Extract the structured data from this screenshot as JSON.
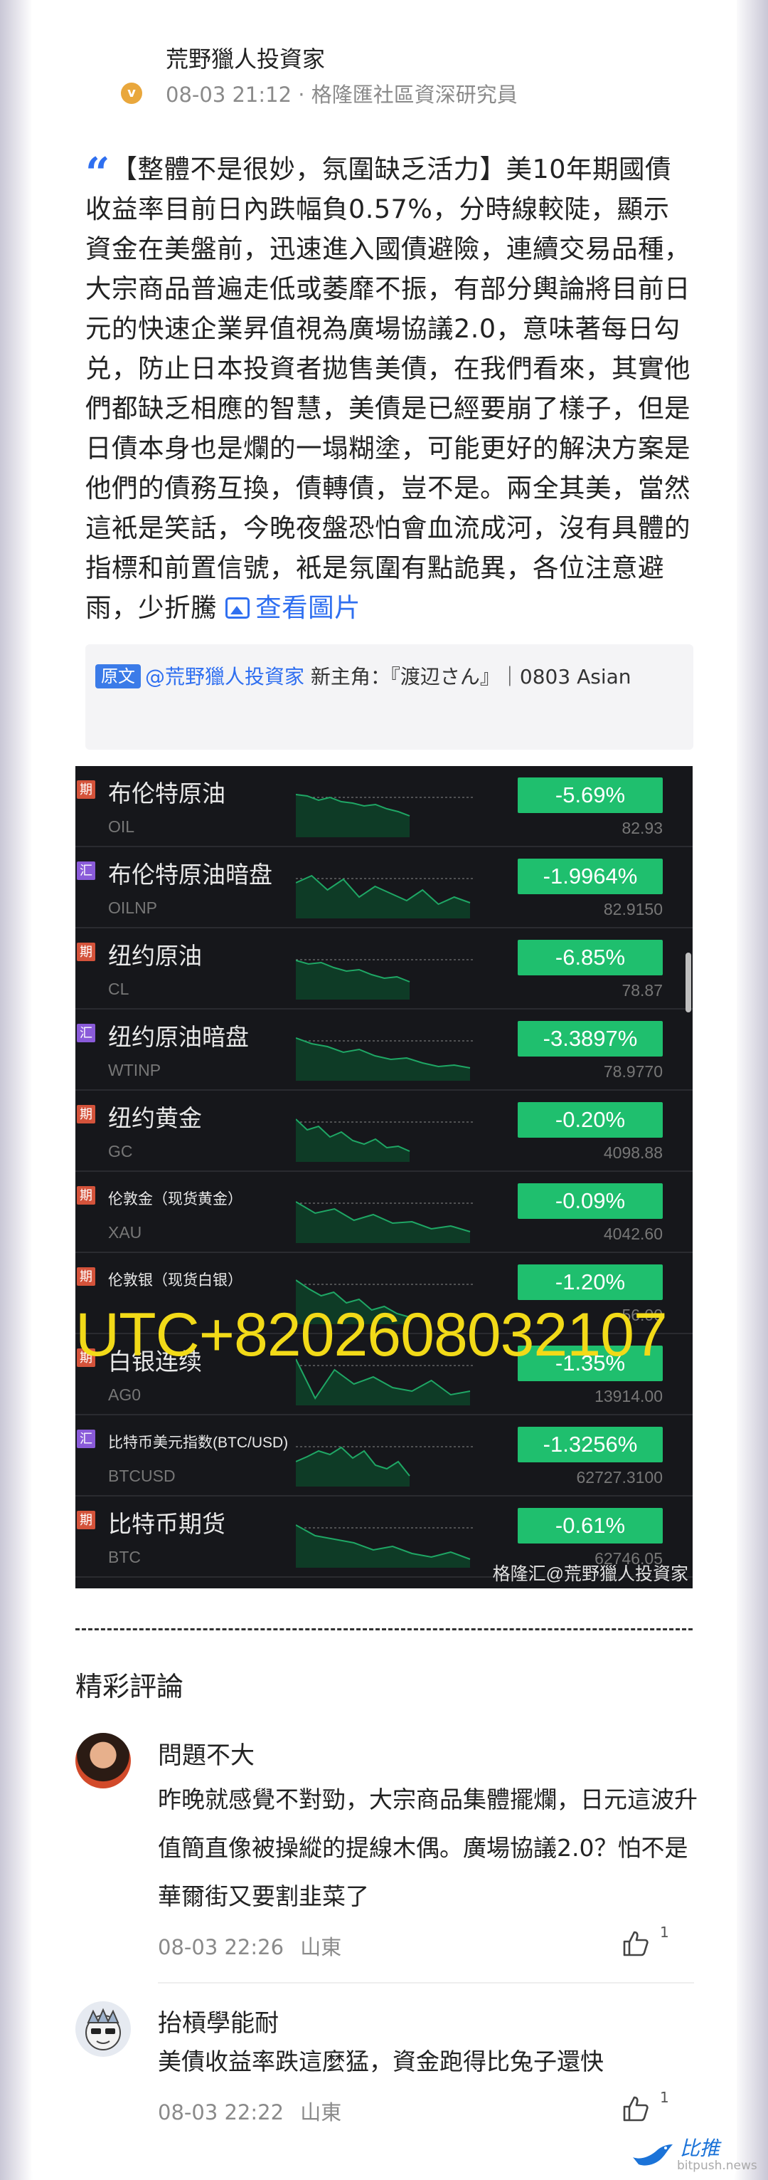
{
  "post": {
    "author": "荒野獵人投資家",
    "timestamp": "08-03 21:12",
    "author_title": "格隆匯社區資深研究員",
    "body": "【整體不是很妙，氛圍缺乏活力】美10年期國債收益率目前日內跌幅負0.57%，分時線較陡，顯示資金在美盤前，迅速進入國債避險，連續交易品種，大宗商品普遍走低或萎靡不振，有部分輿論將目前日元的快速企業昇值視為廣場協議2.0，意味著每日勾兑，防止日本投資者拋售美債，在我們看來，其實他們都缺乏相應的智慧，美債是已經要崩了樣子，但是日債本身也是爛的一塌糊塗，可能更好的解決方案是他們的債務互換，債轉債，豈不是。兩全其美，當然這衹是笑話，今晚夜盤恐怕會血流成河，沒有具體的指標和前置信號，衹是氛圍有點詭異，各位注意避雨，少折騰",
    "view_image": "查看圖片",
    "meta_separator": "·"
  },
  "origin": {
    "tag": "原文",
    "author": "@荒野獵人投資家",
    "text": " 新主角：『渡辺さん』｜0803 Asian"
  },
  "market": {
    "colors": {
      "up": "#1fbf6e",
      "futures_tag": "#d4533b",
      "fx_tag": "#8a5bd9",
      "line": "#1fa765"
    },
    "rows": [
      {
        "tag": "期",
        "tag_type": "futures",
        "name": "布伦特原油",
        "code": "OIL",
        "change": "-5.69%",
        "price": "82.93",
        "small": false
      },
      {
        "tag": "汇",
        "tag_type": "fx",
        "name": "布伦特原油暗盘",
        "code": "OILNP",
        "change": "-1.9964%",
        "price": "82.9150",
        "small": false
      },
      {
        "tag": "期",
        "tag_type": "futures",
        "name": "纽约原油",
        "code": "CL",
        "change": "-6.85%",
        "price": "78.87",
        "small": false
      },
      {
        "tag": "汇",
        "tag_type": "fx",
        "name": "纽约原油暗盘",
        "code": "WTINP",
        "change": "-3.3897%",
        "price": "78.9770",
        "small": false
      },
      {
        "tag": "期",
        "tag_type": "futures",
        "name": "纽约黄金",
        "code": "GC",
        "change": "-0.20%",
        "price": "4098.88",
        "small": false
      },
      {
        "tag": "期",
        "tag_type": "futures",
        "name": "伦敦金（现货黄金）",
        "code": "XAU",
        "change": "-0.09%",
        "price": "4042.60",
        "small": true
      },
      {
        "tag": "期",
        "tag_type": "futures",
        "name": "伦敦银（现货白银）",
        "code": "",
        "change": "-1.20%",
        "price": "56.00",
        "small": true
      },
      {
        "tag": "期",
        "tag_type": "futures",
        "name": "白银连续",
        "code": "AG0",
        "change": "-1.35%",
        "price": "13914.00",
        "small": false
      },
      {
        "tag": "汇",
        "tag_type": "fx",
        "name": "比特币美元指数(BTC/USD)",
        "code": "BTCUSD",
        "change": "-1.3256%",
        "price": "62727.3100",
        "small": true
      },
      {
        "tag": "期",
        "tag_type": "futures",
        "name": "比特币期货",
        "code": "BTC",
        "change": "-0.61%",
        "price": "62746.05",
        "small": false
      }
    ],
    "overlay": "UTC+8202608032107",
    "watermark": "格隆汇@荒野獵人投資家"
  },
  "comments_title": "精彩評論",
  "comments": [
    {
      "name": "問題不大",
      "text": "昨晚就感覺不對勁，大宗商品集體擺爛，日元這波升值簡直像被操縱的提線木偶。廣場協議2.0？怕不是華爾街又要割韭菜了",
      "time": "08-03 22:26",
      "location": "山東",
      "likes": "1"
    },
    {
      "name": "抬槓學能耐",
      "text": "美債收益率跌這麼猛，資金跑得比兔子還快",
      "time": "08-03 22:22",
      "location": "山東",
      "likes": "1"
    }
  ],
  "site": {
    "name": "比推",
    "url": "bitpush.news"
  }
}
